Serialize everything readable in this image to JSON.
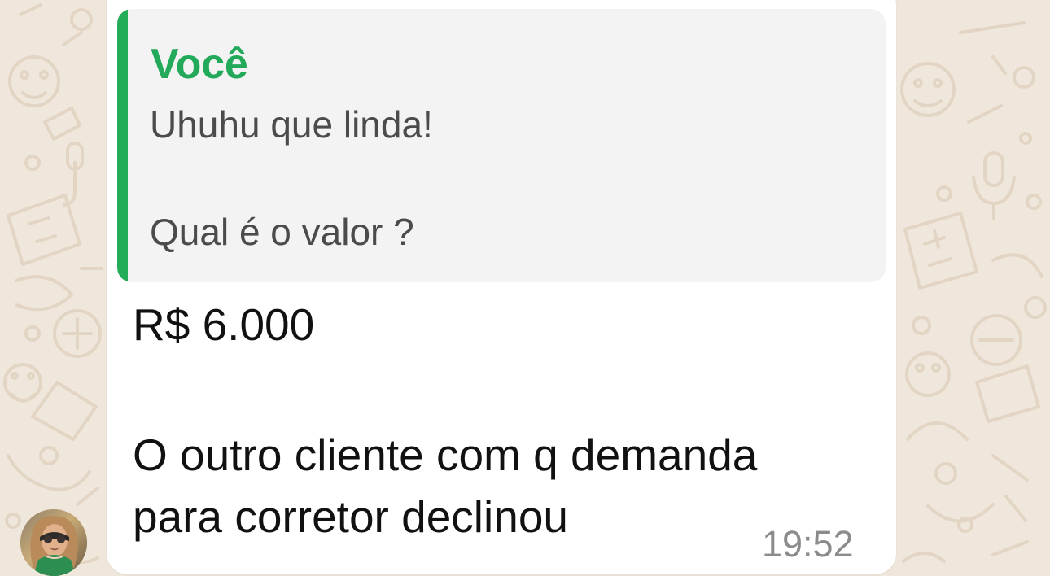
{
  "quote": {
    "author": "Você",
    "lines": [
      "Uhuhu que linda!",
      "Qual é o valor ?"
    ]
  },
  "message": {
    "lines": [
      "R$ 6.000",
      "O outro cliente com q demanda",
      "para corretor declinou"
    ],
    "time": "19:52"
  },
  "colors": {
    "background": "#efe7dc",
    "bubble": "#ffffff",
    "quote_background": "#f4f3f4",
    "accent": "#23ad59"
  },
  "icons": {
    "avatar": "contact-avatar"
  }
}
